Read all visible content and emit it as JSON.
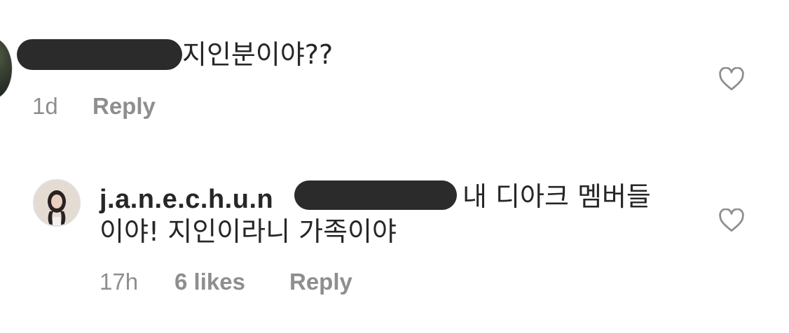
{
  "comments": [
    {
      "text": "지인분이야??",
      "time": "1d",
      "reply_label": "Reply"
    },
    {
      "username": "j.a.n.e.c.h.u.n",
      "line1": "내 디아크 멤버들",
      "line2": "이야! 지인이라니 가족이야",
      "time": "17h",
      "likes": "6 likes",
      "reply_label": "Reply"
    }
  ]
}
